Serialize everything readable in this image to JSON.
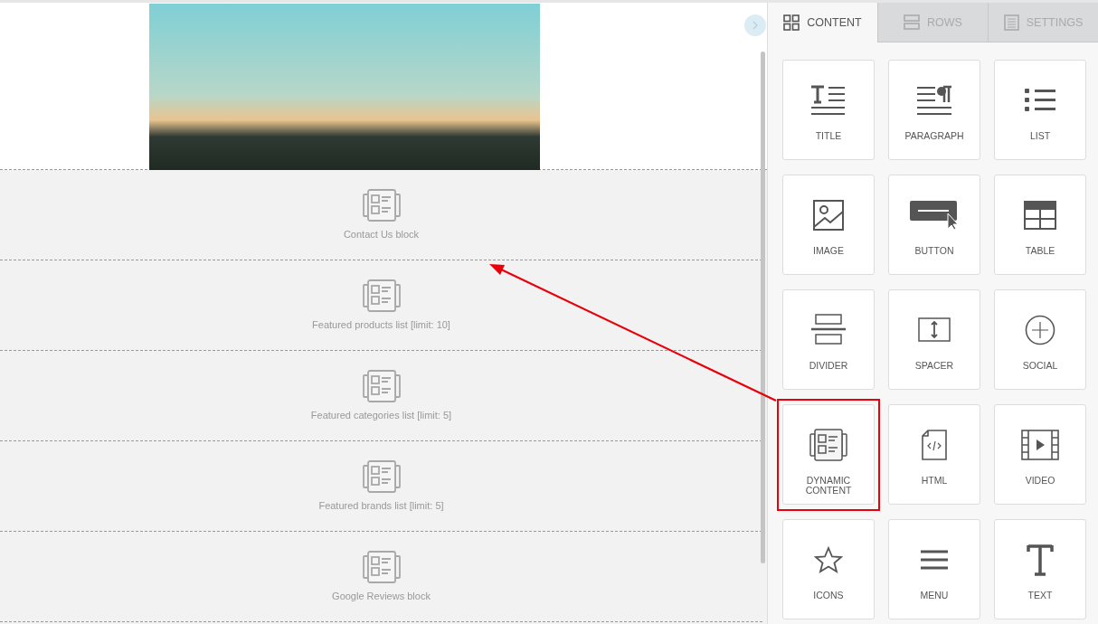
{
  "canvas": {
    "blocks": [
      {
        "label": "Contact Us block"
      },
      {
        "label": "Featured products list [limit: 10]"
      },
      {
        "label": "Featured categories list [limit: 5]"
      },
      {
        "label": "Featured brands list [limit: 5]"
      },
      {
        "label": "Google Reviews block"
      }
    ]
  },
  "panel": {
    "tabs": [
      {
        "label": "CONTENT",
        "selected": true
      },
      {
        "label": "ROWS",
        "selected": false
      },
      {
        "label": "SETTINGS",
        "selected": false
      }
    ],
    "tiles": [
      {
        "label": "TITLE",
        "highlighted": false
      },
      {
        "label": "PARAGRAPH",
        "highlighted": false
      },
      {
        "label": "LIST",
        "highlighted": false
      },
      {
        "label": "IMAGE",
        "highlighted": false
      },
      {
        "label": "BUTTON",
        "highlighted": false
      },
      {
        "label": "TABLE",
        "highlighted": false
      },
      {
        "label": "DIVIDER",
        "highlighted": false
      },
      {
        "label": "SPACER",
        "highlighted": false
      },
      {
        "label": "SOCIAL",
        "highlighted": false
      },
      {
        "label": "DYNAMIC CONTENT",
        "highlighted": true
      },
      {
        "label": "HTML",
        "highlighted": false
      },
      {
        "label": "VIDEO",
        "highlighted": false
      },
      {
        "label": "ICONS",
        "highlighted": false
      },
      {
        "label": "MENU",
        "highlighted": false
      },
      {
        "label": "TEXT",
        "highlighted": false
      }
    ]
  }
}
